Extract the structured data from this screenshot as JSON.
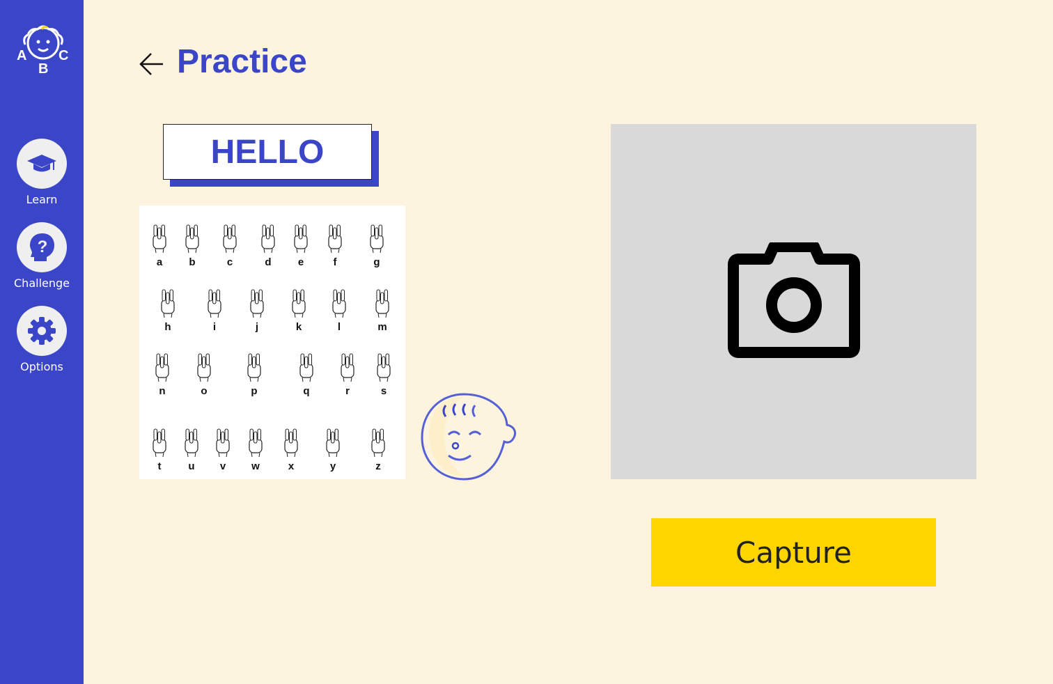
{
  "logo": {
    "icon": "baby-face-abc-logo",
    "letters": [
      "A",
      "B",
      "C"
    ]
  },
  "sidebar": {
    "items": [
      {
        "label": "Learn",
        "icon": "graduation-cap-icon"
      },
      {
        "label": "Challenge",
        "icon": "head-question-icon"
      },
      {
        "label": "Options",
        "icon": "gear-icon"
      }
    ]
  },
  "header": {
    "title": "Practice",
    "back_icon": "arrow-left-icon"
  },
  "practice": {
    "word": "HELLO",
    "alphabet": [
      [
        "a",
        "b",
        "c",
        "d",
        "e",
        "f",
        "g"
      ],
      [
        "h",
        "i",
        "j",
        "k",
        "l",
        "m"
      ],
      [
        "n",
        "o",
        "p",
        "q",
        "r",
        "s"
      ],
      [
        "t",
        "u",
        "v",
        "w",
        "x",
        "y",
        "z"
      ]
    ]
  },
  "camera": {
    "icon": "camera-icon",
    "capture_label": "Capture"
  },
  "colors": {
    "brand": "#3A45C8",
    "background": "#FCF4DF",
    "accent": "#FFD500",
    "camera_bg": "#D9D9D9"
  }
}
